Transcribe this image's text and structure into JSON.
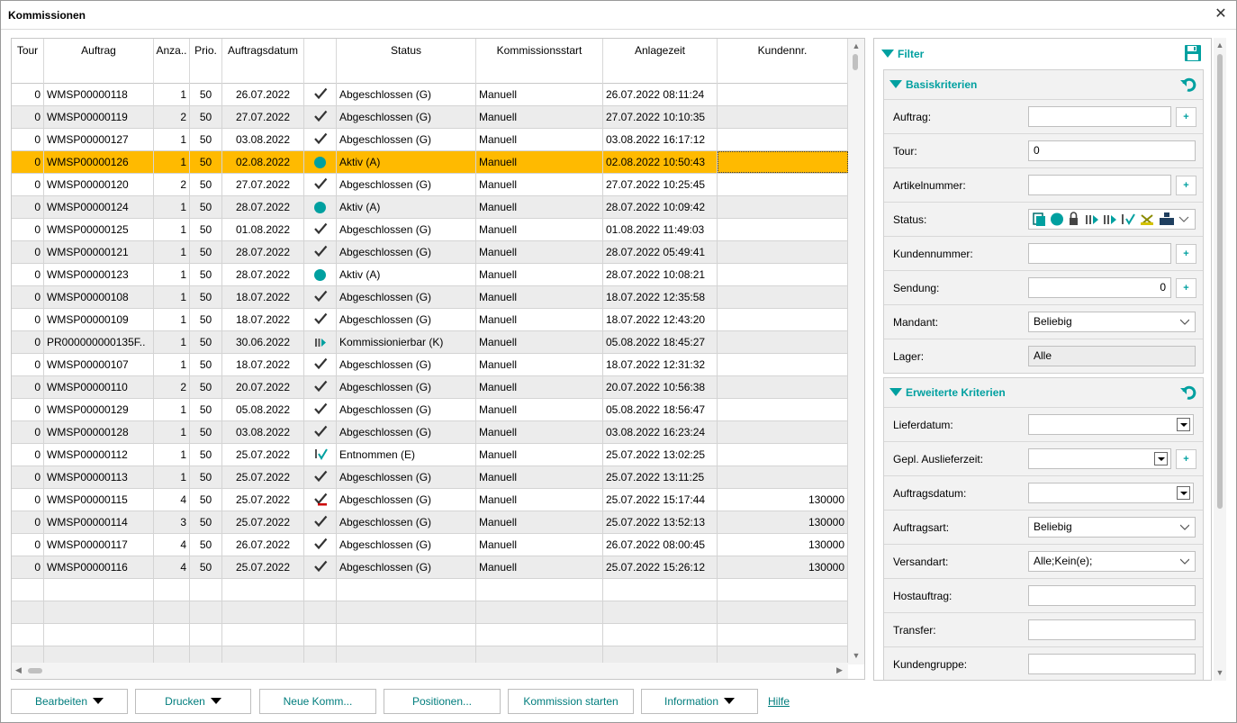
{
  "window": {
    "title": "Kommissionen",
    "close_glyph": "✕"
  },
  "columns": [
    {
      "key": "tour",
      "label": "Tour"
    },
    {
      "key": "auftrag",
      "label": "Auftrag"
    },
    {
      "key": "anzahl",
      "label": "Anza.."
    },
    {
      "key": "prio",
      "label": "Prio."
    },
    {
      "key": "datum",
      "label": "Auftragsdatum"
    },
    {
      "key": "icon",
      "label": ""
    },
    {
      "key": "status",
      "label": "Status"
    },
    {
      "key": "start",
      "label": "Kommissionsstart"
    },
    {
      "key": "anlage",
      "label": "Anlagezeit"
    },
    {
      "key": "kunde",
      "label": "Kundennr."
    }
  ],
  "rows": [
    {
      "tour": "0",
      "auftrag": "WMSP00000118",
      "anzahl": "1",
      "prio": "50",
      "datum": "26.07.2022",
      "icon": "check",
      "status": "Abgeschlossen (G)",
      "start": "Manuell",
      "anlage": "26.07.2022 08:11:24",
      "kunde": ""
    },
    {
      "tour": "0",
      "auftrag": "WMSP00000119",
      "anzahl": "2",
      "prio": "50",
      "datum": "27.07.2022",
      "icon": "check",
      "status": "Abgeschlossen (G)",
      "start": "Manuell",
      "anlage": "27.07.2022 10:10:35",
      "kunde": ""
    },
    {
      "tour": "0",
      "auftrag": "WMSP00000127",
      "anzahl": "1",
      "prio": "50",
      "datum": "03.08.2022",
      "icon": "check",
      "status": "Abgeschlossen (G)",
      "start": "Manuell",
      "anlage": "03.08.2022 16:17:12",
      "kunde": ""
    },
    {
      "tour": "0",
      "auftrag": "WMSP00000126",
      "anzahl": "1",
      "prio": "50",
      "datum": "02.08.2022",
      "icon": "dot",
      "status": "Aktiv (A)",
      "start": "Manuell",
      "anlage": "02.08.2022 10:50:43",
      "kunde": "",
      "selected": true
    },
    {
      "tour": "0",
      "auftrag": "WMSP00000120",
      "anzahl": "2",
      "prio": "50",
      "datum": "27.07.2022",
      "icon": "check",
      "status": "Abgeschlossen (G)",
      "start": "Manuell",
      "anlage": "27.07.2022 10:25:45",
      "kunde": ""
    },
    {
      "tour": "0",
      "auftrag": "WMSP00000124",
      "anzahl": "1",
      "prio": "50",
      "datum": "28.07.2022",
      "icon": "dot",
      "status": "Aktiv (A)",
      "start": "Manuell",
      "anlage": "28.07.2022 10:09:42",
      "kunde": ""
    },
    {
      "tour": "0",
      "auftrag": "WMSP00000125",
      "anzahl": "1",
      "prio": "50",
      "datum": "01.08.2022",
      "icon": "check",
      "status": "Abgeschlossen (G)",
      "start": "Manuell",
      "anlage": "01.08.2022 11:49:03",
      "kunde": ""
    },
    {
      "tour": "0",
      "auftrag": "WMSP00000121",
      "anzahl": "1",
      "prio": "50",
      "datum": "28.07.2022",
      "icon": "check",
      "status": "Abgeschlossen (G)",
      "start": "Manuell",
      "anlage": "28.07.2022 05:49:41",
      "kunde": ""
    },
    {
      "tour": "0",
      "auftrag": "WMSP00000123",
      "anzahl": "1",
      "prio": "50",
      "datum": "28.07.2022",
      "icon": "dot",
      "status": "Aktiv (A)",
      "start": "Manuell",
      "anlage": "28.07.2022 10:08:21",
      "kunde": ""
    },
    {
      "tour": "0",
      "auftrag": "WMSP00000108",
      "anzahl": "1",
      "prio": "50",
      "datum": "18.07.2022",
      "icon": "check",
      "status": "Abgeschlossen (G)",
      "start": "Manuell",
      "anlage": "18.07.2022 12:35:58",
      "kunde": ""
    },
    {
      "tour": "0",
      "auftrag": "WMSP00000109",
      "anzahl": "1",
      "prio": "50",
      "datum": "18.07.2022",
      "icon": "check",
      "status": "Abgeschlossen (G)",
      "start": "Manuell",
      "anlage": "18.07.2022 12:43:20",
      "kunde": ""
    },
    {
      "tour": "0",
      "auftrag": "PR000000000135F..",
      "anzahl": "1",
      "prio": "50",
      "datum": "30.06.2022",
      "icon": "kommissionierbar",
      "status": "Kommissionierbar (K)",
      "start": "Manuell",
      "anlage": "05.08.2022 18:45:27",
      "kunde": ""
    },
    {
      "tour": "0",
      "auftrag": "WMSP00000107",
      "anzahl": "1",
      "prio": "50",
      "datum": "18.07.2022",
      "icon": "check",
      "status": "Abgeschlossen (G)",
      "start": "Manuell",
      "anlage": "18.07.2022 12:31:32",
      "kunde": ""
    },
    {
      "tour": "0",
      "auftrag": "WMSP00000110",
      "anzahl": "2",
      "prio": "50",
      "datum": "20.07.2022",
      "icon": "check",
      "status": "Abgeschlossen (G)",
      "start": "Manuell",
      "anlage": "20.07.2022 10:56:38",
      "kunde": ""
    },
    {
      "tour": "0",
      "auftrag": "WMSP00000129",
      "anzahl": "1",
      "prio": "50",
      "datum": "05.08.2022",
      "icon": "check",
      "status": "Abgeschlossen (G)",
      "start": "Manuell",
      "anlage": "05.08.2022 18:56:47",
      "kunde": ""
    },
    {
      "tour": "0",
      "auftrag": "WMSP00000128",
      "anzahl": "1",
      "prio": "50",
      "datum": "03.08.2022",
      "icon": "check",
      "status": "Abgeschlossen (G)",
      "start": "Manuell",
      "anlage": "03.08.2022 16:23:24",
      "kunde": ""
    },
    {
      "tour": "0",
      "auftrag": "WMSP00000112",
      "anzahl": "1",
      "prio": "50",
      "datum": "25.07.2022",
      "icon": "entnommen",
      "status": "Entnommen (E)",
      "start": "Manuell",
      "anlage": "25.07.2022 13:02:25",
      "kunde": ""
    },
    {
      "tour": "0",
      "auftrag": "WMSP00000113",
      "anzahl": "1",
      "prio": "50",
      "datum": "25.07.2022",
      "icon": "check",
      "status": "Abgeschlossen (G)",
      "start": "Manuell",
      "anlage": "25.07.2022 13:11:25",
      "kunde": ""
    },
    {
      "tour": "0",
      "auftrag": "WMSP00000115",
      "anzahl": "4",
      "prio": "50",
      "datum": "25.07.2022",
      "icon": "check-red",
      "status": "Abgeschlossen (G)",
      "start": "Manuell",
      "anlage": "25.07.2022 15:17:44",
      "kunde": "130000"
    },
    {
      "tour": "0",
      "auftrag": "WMSP00000114",
      "anzahl": "3",
      "prio": "50",
      "datum": "25.07.2022",
      "icon": "check",
      "status": "Abgeschlossen (G)",
      "start": "Manuell",
      "anlage": "25.07.2022 13:52:13",
      "kunde": "130000"
    },
    {
      "tour": "0",
      "auftrag": "WMSP00000117",
      "anzahl": "4",
      "prio": "50",
      "datum": "26.07.2022",
      "icon": "check",
      "status": "Abgeschlossen (G)",
      "start": "Manuell",
      "anlage": "26.07.2022 08:00:45",
      "kunde": "130000"
    },
    {
      "tour": "0",
      "auftrag": "WMSP00000116",
      "anzahl": "4",
      "prio": "50",
      "datum": "25.07.2022",
      "icon": "check",
      "status": "Abgeschlossen (G)",
      "start": "Manuell",
      "anlage": "25.07.2022 15:26:12",
      "kunde": "130000"
    }
  ],
  "filter": {
    "title": "Filter",
    "basis": {
      "title": "Basiskriterien",
      "auftrag_label": "Auftrag:",
      "tour_label": "Tour:",
      "tour_value": "0",
      "artikel_label": "Artikelnummer:",
      "status_label": "Status:",
      "kunde_label": "Kundennummer:",
      "sendung_label": "Sendung:",
      "sendung_value": "0",
      "mandant_label": "Mandant:",
      "mandant_value": "Beliebig",
      "lager_label": "Lager:",
      "lager_value": "Alle",
      "plus": "+"
    },
    "erweitert": {
      "title": "Erweiterte Kriterien",
      "liefer_label": "Lieferdatum:",
      "gepl_label": "Gepl. Auslieferzeit:",
      "adatum_label": "Auftragsdatum:",
      "aart_label": "Auftragsart:",
      "aart_value": "Beliebig",
      "vart_label": "Versandart:",
      "vart_value": "Alle;Kein(e);",
      "host_label": "Hostauftrag:",
      "transfer_label": "Transfer:",
      "kgruppe_label": "Kundengruppe:"
    }
  },
  "buttons": {
    "bearbeiten": "Bearbeiten",
    "drucken": "Drucken",
    "neue": "Neue Komm...",
    "positionen": "Positionen...",
    "starten": "Kommission starten",
    "information": "Information",
    "hilfe": "Hilfe"
  },
  "colors": {
    "accent": "#00a0a0",
    "selection": "#ffba00"
  }
}
